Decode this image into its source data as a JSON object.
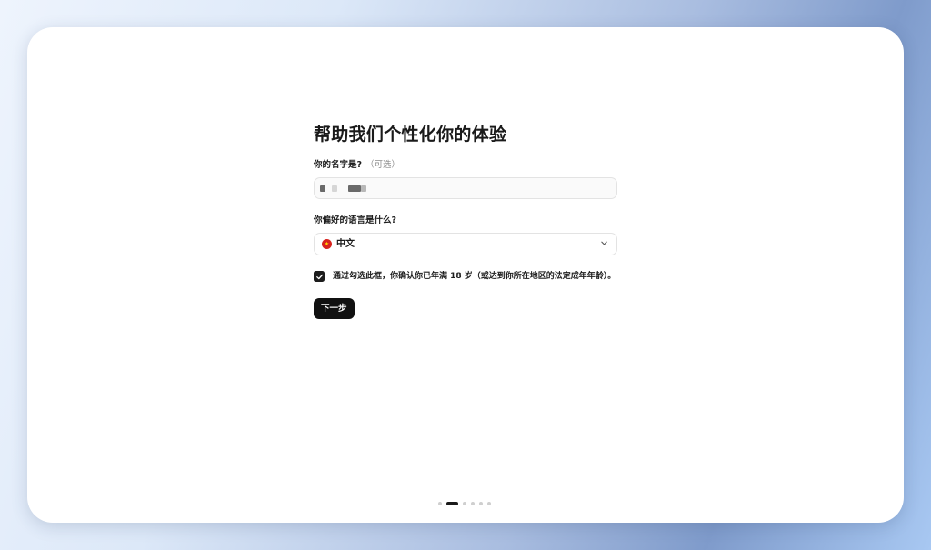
{
  "onboarding": {
    "title": "帮助我们个性化你的体验",
    "name_label": "你的名字是?",
    "name_optional": "（可选）",
    "name_value": "",
    "language_label": "你偏好的语言是什么?",
    "language_flag_icon": "china-flag-icon",
    "language_value": "中文",
    "consent_checked": true,
    "consent_text": "通过勾选此框，你确认你已年满 18 岁（或达到你所在地区的法定成年年龄）。",
    "next_label": "下一步"
  },
  "pagination": {
    "total_steps": 6,
    "current_step": 2
  },
  "colors": {
    "button_bg": "#111111",
    "flag_red": "#d8231e",
    "flag_star": "#ffd800"
  }
}
